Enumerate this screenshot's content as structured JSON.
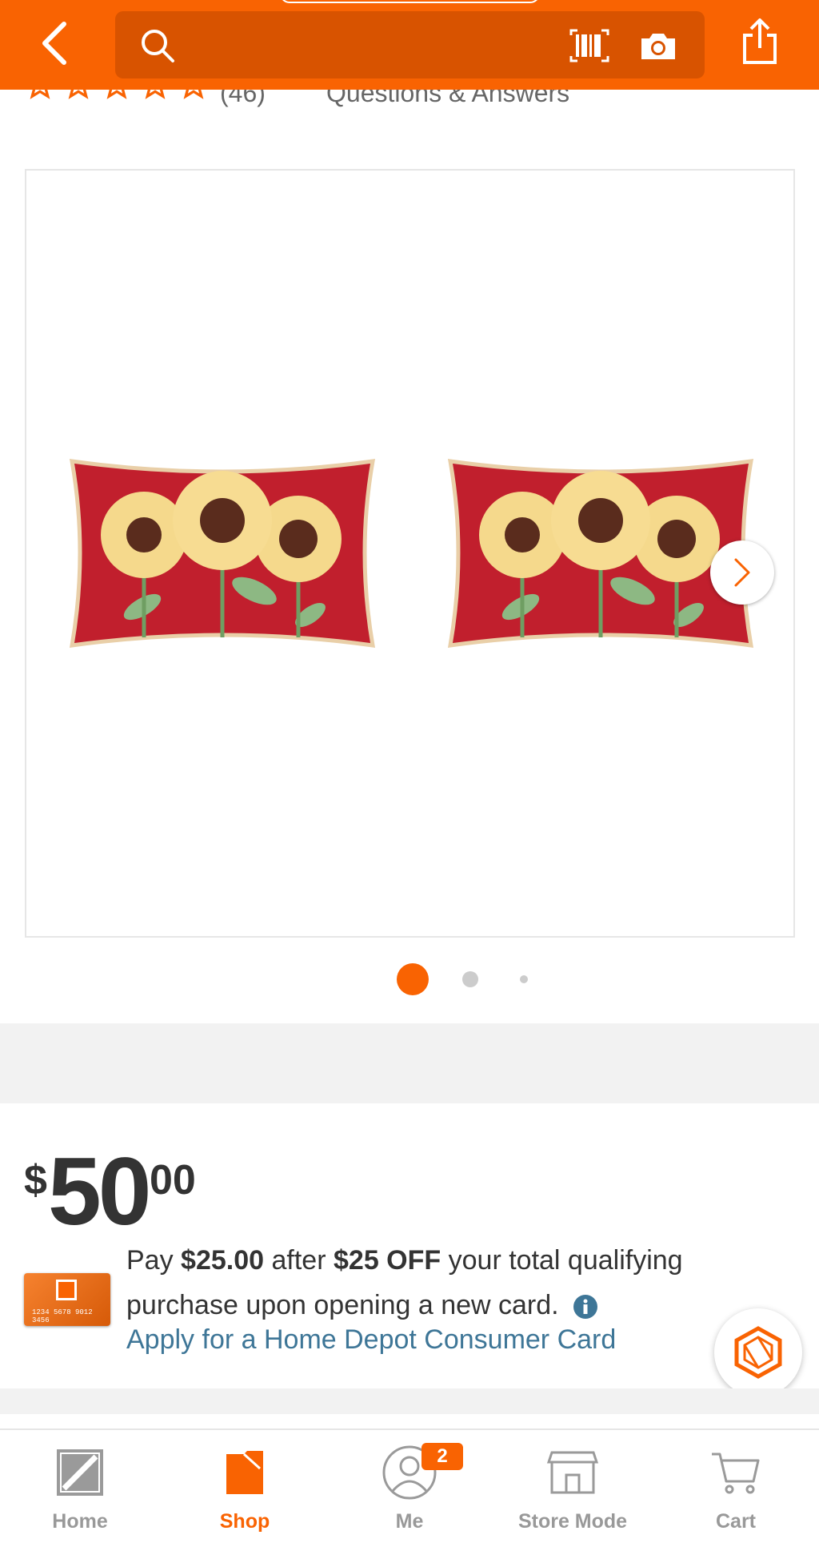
{
  "header": {
    "search_placeholder": "",
    "accent_color": "#f96302",
    "icons": [
      "back-arrow-icon",
      "search-icon",
      "barcode-scanner-icon",
      "camera-icon",
      "share-icon"
    ]
  },
  "rating_strip": {
    "rating_count": "(46)",
    "qa_label": "Questions & Answers"
  },
  "gallery": {
    "slide_count": 3,
    "active_slide": 1
  },
  "price": {
    "currency": "$",
    "dollars": "50",
    "cents": "00"
  },
  "promo": {
    "prefix": "Pay",
    "amount_after": "$25.00",
    "mid": "after",
    "discount": "$25 OFF",
    "suffix_line": "your total qualifying purchase upon opening a new card.",
    "card_number": "1234 5678 9012 3456",
    "apply_link": "Apply for a Home Depot Consumer Card"
  },
  "bottom_nav": {
    "items": [
      {
        "label": "Home",
        "icon": "home-depot-logo-icon"
      },
      {
        "label": "Shop",
        "icon": "shop-tag-icon"
      },
      {
        "label": "Me",
        "icon": "user-icon",
        "badge": "2"
      },
      {
        "label": "Store Mode",
        "icon": "store-icon"
      },
      {
        "label": "Cart",
        "icon": "cart-icon"
      }
    ],
    "active": "Shop"
  }
}
